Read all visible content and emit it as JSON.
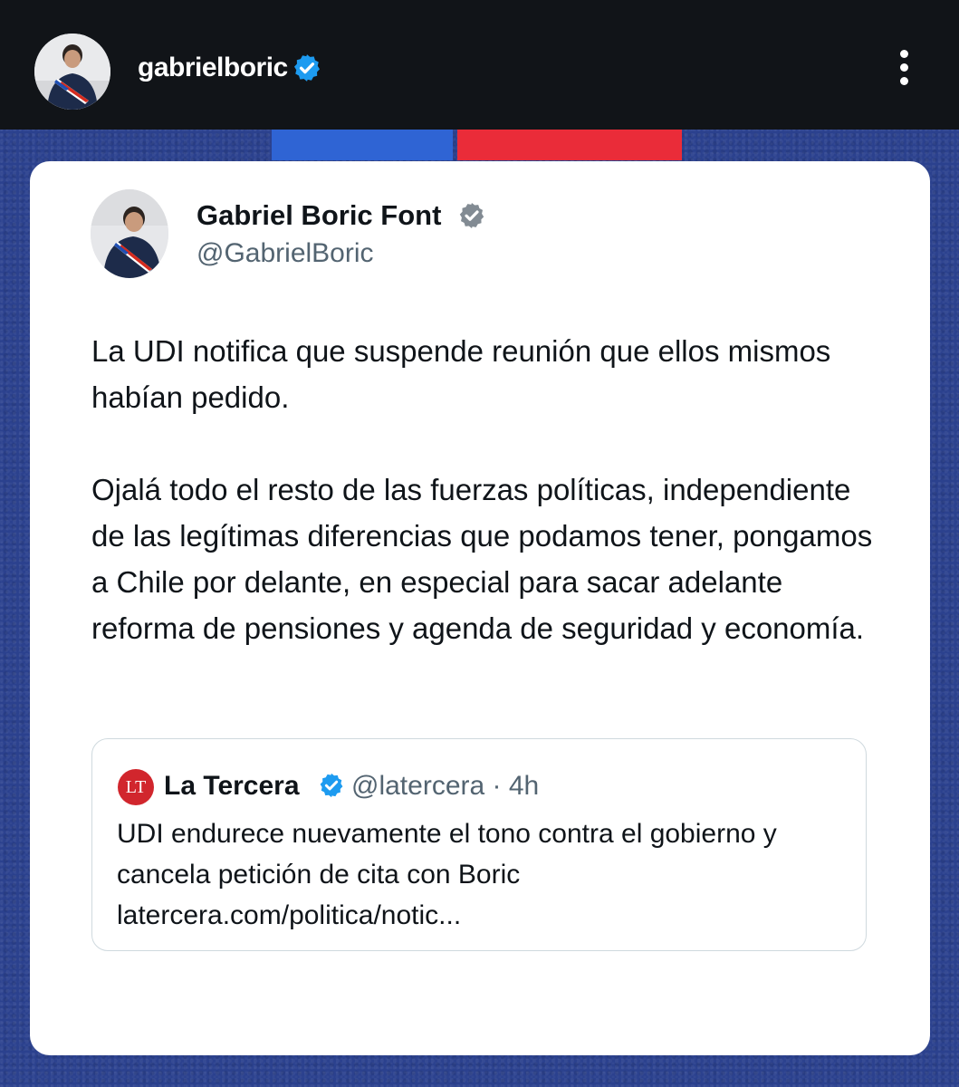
{
  "story_header": {
    "username": "gabrielboric",
    "verified_icon": "verified-badge-icon",
    "menu_icon": "more-vertical-icon"
  },
  "flag_colors": {
    "blue": "#2f64d4",
    "red": "#ea2c39"
  },
  "tweet": {
    "display_name": "Gabriel Boric Font",
    "handle": "@GabrielBoric",
    "paragraphs": [
      "La UDI notifica que suspende reunión que ellos mismos habían pedido.",
      "Ojalá todo el resto de las fuerzas políticas, independiente de las legítimas diferencias que podamos tener, pongamos a Chile por delante, en especial para sacar adelante reforma de pensiones y agenda de seguridad y economía."
    ]
  },
  "quoted_tweet": {
    "logo_text": "LT",
    "display_name": "La Tercera",
    "meta": "@latercera · 4h",
    "text": "UDI endurece nuevamente el tono contra el gobierno y cancela petición de cita con Boric latercera.com/politica/notic..."
  },
  "colors": {
    "verified_blue": "#1d9bf0",
    "background_blue": "#2b418e",
    "topbar": "#111418"
  }
}
